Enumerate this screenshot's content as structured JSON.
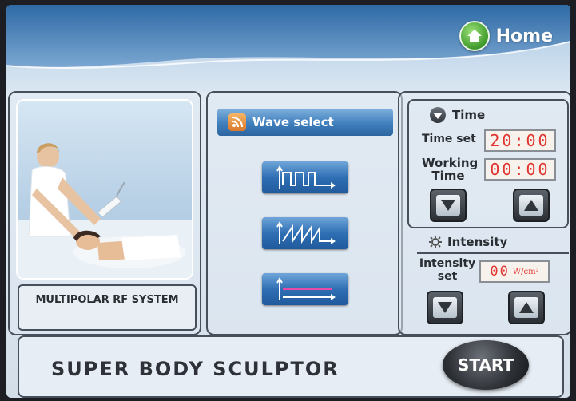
{
  "header": {
    "home_label": "Home"
  },
  "left_panel": {
    "system_label": "MULTIPOLAR RF SYSTEM"
  },
  "wave_select": {
    "title": "Wave select",
    "options": [
      {
        "name": "square-wave"
      },
      {
        "name": "sawtooth-wave"
      },
      {
        "name": "continuous-wave"
      }
    ]
  },
  "time": {
    "title": "Time",
    "time_set_label": "Time set",
    "time_set_value": "20:00",
    "working_time_label": "Working Time",
    "working_time_value": "00:00"
  },
  "intensity": {
    "title": "Intensity",
    "set_label": "Intensity set",
    "value": "00",
    "unit": "W/cm²"
  },
  "footer": {
    "product_name": "SUPER BODY SCULPTOR",
    "start_label": "START"
  },
  "colors": {
    "lcd_text": "#e0342f",
    "button_blue": "#2f6fb4"
  }
}
